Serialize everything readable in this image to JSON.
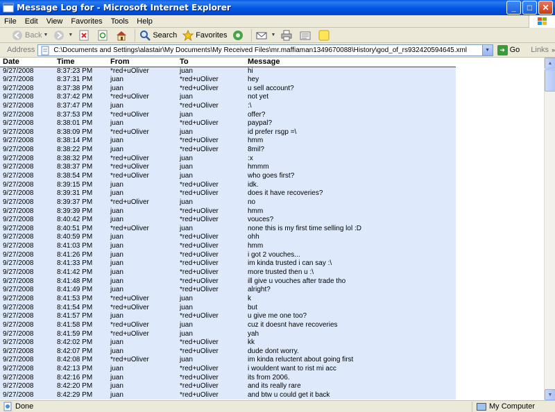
{
  "window": {
    "title": "Message Log for - Microsoft Internet Explorer"
  },
  "menu": [
    "File",
    "Edit",
    "View",
    "Favorites",
    "Tools",
    "Help"
  ],
  "toolbar": {
    "back": "Back",
    "search": "Search",
    "favorites": "Favorites"
  },
  "address": {
    "label": "Address",
    "url": "C:\\Documents and Settings\\alastair\\My Documents\\My Received Files\\mr.maffiaman1349670088\\History\\god_of_rs932420594645.xml",
    "go": "Go",
    "links": "Links"
  },
  "table": {
    "headers": [
      "Date",
      "Time",
      "From",
      "To",
      "Message"
    ],
    "rows": [
      [
        "9/27/2008",
        "8:37:23 PM",
        "*red+uOliver",
        "juan",
        "hi"
      ],
      [
        "9/27/2008",
        "8:37:31 PM",
        "juan",
        "*red+uOliver",
        "hey"
      ],
      [
        "9/27/2008",
        "8:37:38 PM",
        "juan",
        "*red+uOliver",
        "u sell account?"
      ],
      [
        "9/27/2008",
        "8:37:42 PM",
        "*red+uOliver",
        "juan",
        "not yet"
      ],
      [
        "9/27/2008",
        "8:37:47 PM",
        "juan",
        "*red+uOliver",
        ":\\"
      ],
      [
        "9/27/2008",
        "8:37:53 PM",
        "*red+uOliver",
        "juan",
        "offer?"
      ],
      [
        "9/27/2008",
        "8:38:01 PM",
        "juan",
        "*red+uOliver",
        "paypal?"
      ],
      [
        "9/27/2008",
        "8:38:09 PM",
        "*red+uOliver",
        "juan",
        "id prefer rsgp =\\"
      ],
      [
        "9/27/2008",
        "8:38:14 PM",
        "juan",
        "*red+uOliver",
        "hmm"
      ],
      [
        "9/27/2008",
        "8:38:22 PM",
        "juan",
        "*red+uOliver",
        "8mil?"
      ],
      [
        "9/27/2008",
        "8:38:32 PM",
        "*red+uOliver",
        "juan",
        ":x"
      ],
      [
        "9/27/2008",
        "8:38:37 PM",
        "*red+uOliver",
        "juan",
        "hmmm"
      ],
      [
        "9/27/2008",
        "8:38:54 PM",
        "*red+uOliver",
        "juan",
        "who goes first?"
      ],
      [
        "9/27/2008",
        "8:39:15 PM",
        "juan",
        "*red+uOliver",
        "idk."
      ],
      [
        "9/27/2008",
        "8:39:31 PM",
        "juan",
        "*red+uOliver",
        "does it have recoveries?"
      ],
      [
        "9/27/2008",
        "8:39:37 PM",
        "*red+uOliver",
        "juan",
        "no"
      ],
      [
        "9/27/2008",
        "8:39:39 PM",
        "juan",
        "*red+uOliver",
        "hmm"
      ],
      [
        "9/27/2008",
        "8:40:42 PM",
        "juan",
        "*red+uOliver",
        "vouces?"
      ],
      [
        "9/27/2008",
        "8:40:51 PM",
        "*red+uOliver",
        "juan",
        "none this is my first time selling lol :D"
      ],
      [
        "9/27/2008",
        "8:40:59 PM",
        "juan",
        "*red+uOliver",
        "ohh"
      ],
      [
        "9/27/2008",
        "8:41:03 PM",
        "juan",
        "*red+uOliver",
        "hmm"
      ],
      [
        "9/27/2008",
        "8:41:26 PM",
        "juan",
        "*red+uOliver",
        "i got 2 vouches..."
      ],
      [
        "9/27/2008",
        "8:41:33 PM",
        "juan",
        "*red+uOliver",
        "im kinda trusted i can say :\\"
      ],
      [
        "9/27/2008",
        "8:41:42 PM",
        "juan",
        "*red+uOliver",
        "more trusted then u :\\"
      ],
      [
        "9/27/2008",
        "8:41:48 PM",
        "juan",
        "*red+uOliver",
        "ill give u vouches after trade tho"
      ],
      [
        "9/27/2008",
        "8:41:49 PM",
        "juan",
        "*red+uOliver",
        "alright?"
      ],
      [
        "9/27/2008",
        "8:41:53 PM",
        "*red+uOliver",
        "juan",
        "k"
      ],
      [
        "9/27/2008",
        "8:41:54 PM",
        "*red+uOliver",
        "juan",
        "but"
      ],
      [
        "9/27/2008",
        "8:41:57 PM",
        "juan",
        "*red+uOliver",
        "u give me one too?"
      ],
      [
        "9/27/2008",
        "8:41:58 PM",
        "*red+uOliver",
        "juan",
        "cuz it doesnt have recoveries"
      ],
      [
        "9/27/2008",
        "8:41:59 PM",
        "*red+uOliver",
        "juan",
        "yah"
      ],
      [
        "9/27/2008",
        "8:42:02 PM",
        "juan",
        "*red+uOliver",
        "kk"
      ],
      [
        "9/27/2008",
        "8:42:07 PM",
        "juan",
        "*red+uOliver",
        "dude dont worry."
      ],
      [
        "9/27/2008",
        "8:42:08 PM",
        "*red+uOliver",
        "juan",
        "im kinda reluctent about going first"
      ],
      [
        "9/27/2008",
        "8:42:13 PM",
        "juan",
        "*red+uOliver",
        "i wouldent want to rist mi acc"
      ],
      [
        "9/27/2008",
        "8:42:16 PM",
        "juan",
        "*red+uOliver",
        "its from 2006."
      ],
      [
        "9/27/2008",
        "8:42:20 PM",
        "juan",
        "*red+uOliver",
        "and its really rare"
      ],
      [
        "9/27/2008",
        "8:42:29 PM",
        "juan",
        "*red+uOliver",
        "and btw u could get it back"
      ]
    ]
  },
  "status": {
    "left": "Done",
    "zone": "My Computer"
  },
  "colors": {
    "titlebar": "#0055e5",
    "row_background": "#deeafb",
    "chrome": "#ece9d8"
  }
}
